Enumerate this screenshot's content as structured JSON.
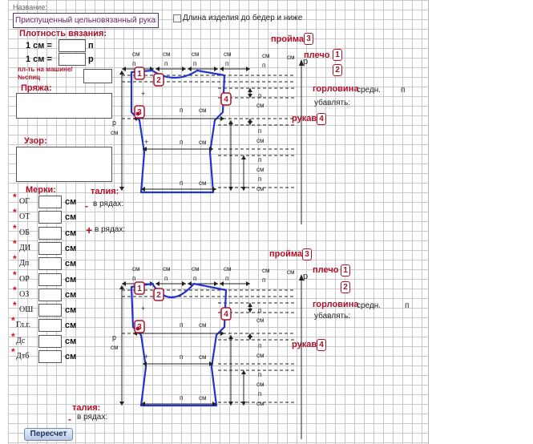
{
  "form": {
    "name_label": "Название:",
    "name_value": "Приспущенный цельновязанный рукав",
    "length_checkbox_label": "Длина изделия до бедер и ниже",
    "density_title": "Плотность вязания:",
    "one_cm": "1 см =",
    "unit_p_stitch": "п",
    "unit_r_row": "р",
    "machine_needle_label": "пл-ть на машине/ №спиц",
    "yarn_label": "Пряжа:",
    "pattern_label": "Узор:",
    "measurements_label": "Мерки:",
    "measurement_unit": "см",
    "measurements": [
      "ОГ",
      "ОТ",
      "ОБ",
      "ДИ",
      "Дп",
      "ОР",
      "ОЗ",
      "ОШ",
      "Гл.г.",
      "Дс",
      "Дтб"
    ],
    "recalc_button": "Пересчет"
  },
  "diagram_labels": {
    "cm": "см",
    "p": "п",
    "r": "р",
    "armhole": "пройма",
    "shoulder": "плечо",
    "neckline": "горловина",
    "neckline_suffix": "средн.",
    "decrease": "убавлять:",
    "sleeve": "рукав",
    "waist": "талия:",
    "in_rows": "в рядах:"
  },
  "badges": {
    "armhole": "3",
    "shoulder_1": "1",
    "shoulder_2": "2",
    "sleeve": "4",
    "marker_1": "1",
    "marker_2": "2",
    "marker_3": "3",
    "marker_4": "4"
  },
  "colors": {
    "accent_red": "#b01028",
    "garment_blue": "#2233cc",
    "grid": "#c8c8c8"
  }
}
